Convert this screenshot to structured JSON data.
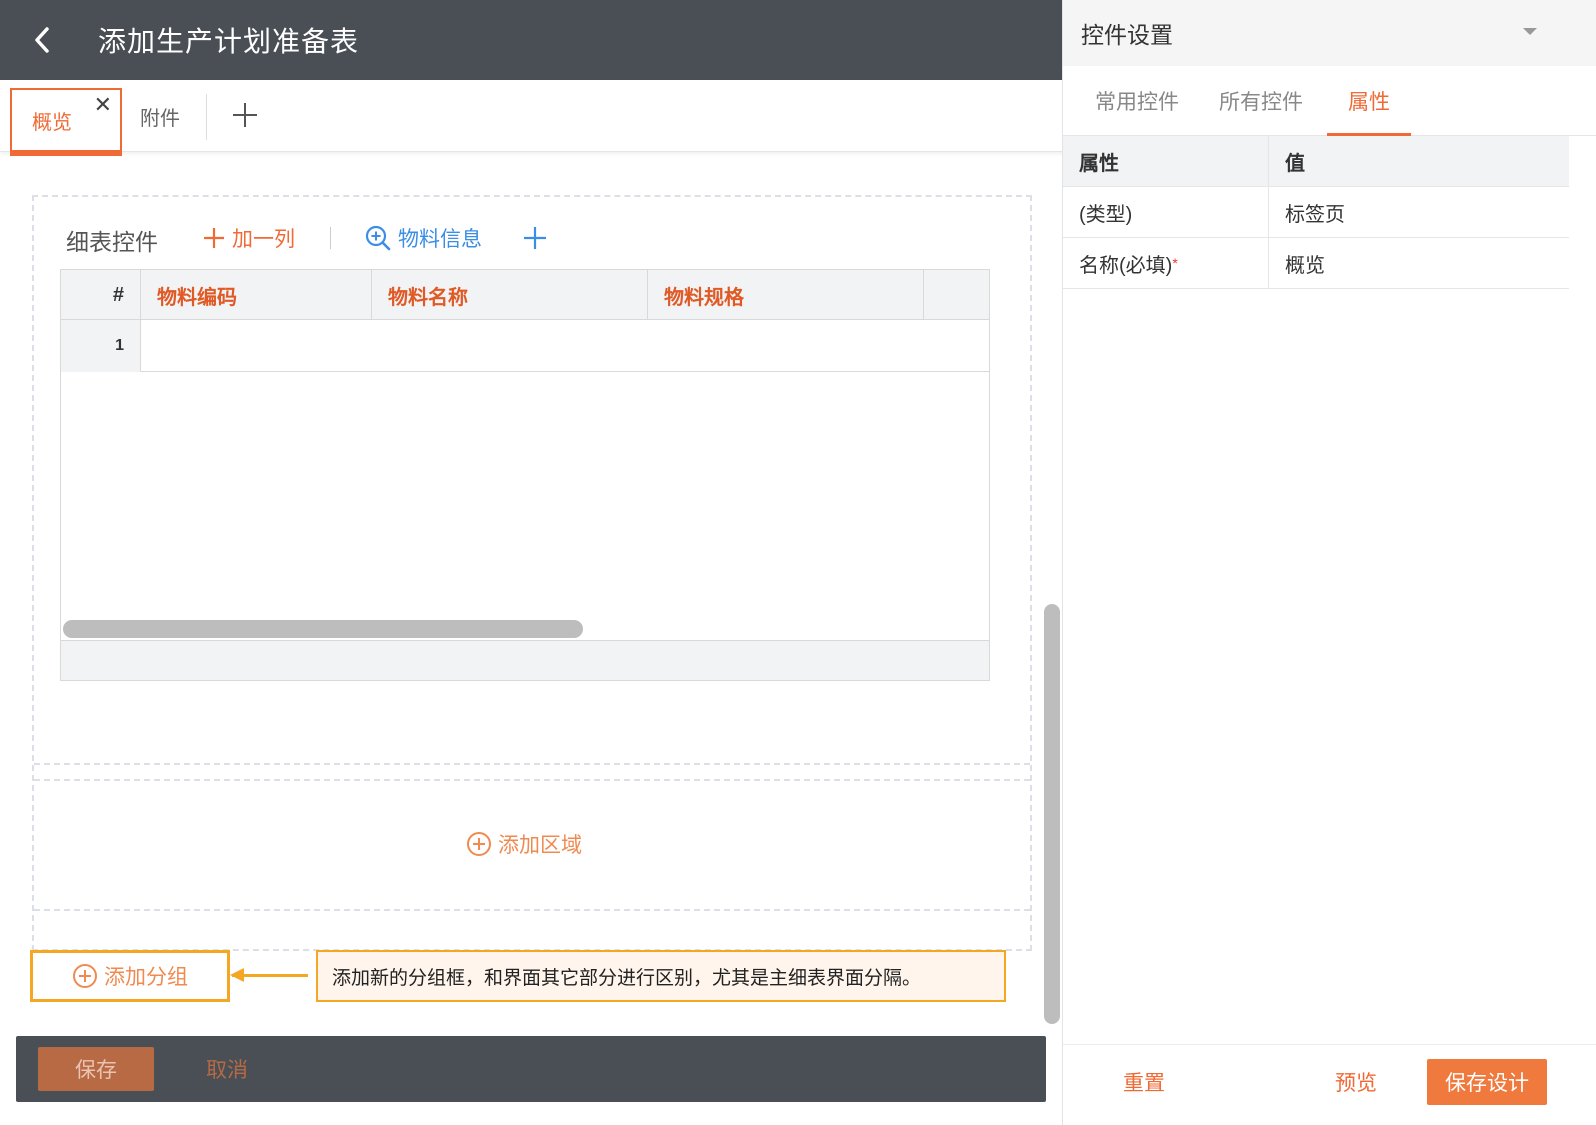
{
  "header": {
    "title": "添加生产计划准备表"
  },
  "tabs": {
    "overview": "概览",
    "attachment": "附件",
    "close_glyph": "✕"
  },
  "detail": {
    "label": "细表控件",
    "add_column": "加一列",
    "material_info": "物料信息",
    "columns": [
      "#",
      "物料编码",
      "物料名称",
      "物料规格"
    ],
    "rows": [
      {
        "index": "1"
      }
    ]
  },
  "add_region": "添加区域",
  "add_group": "添加分组",
  "callout": "添加新的分组框，和界面其它部分进行区别，尤其是主细表界面分隔。",
  "footer": {
    "save": "保存",
    "cancel": "取消"
  },
  "panel": {
    "title": "控件设置",
    "tabs": [
      "常用控件",
      "所有控件",
      "属性"
    ],
    "active_tab": "属性",
    "table_head": {
      "key": "属性",
      "value": "值"
    },
    "rows": [
      {
        "key": "(类型)",
        "value": "标签页"
      },
      {
        "key": "名称(必填)",
        "value": "概览",
        "required_mark": "*"
      }
    ],
    "buttons": {
      "reset": "重置",
      "preview": "预览",
      "save_design": "保存设计"
    }
  },
  "colors": {
    "accent": "#f06a35",
    "header_bg": "#4a4f56",
    "link_blue": "#3b8ee6",
    "highlight": "#f5a623"
  }
}
